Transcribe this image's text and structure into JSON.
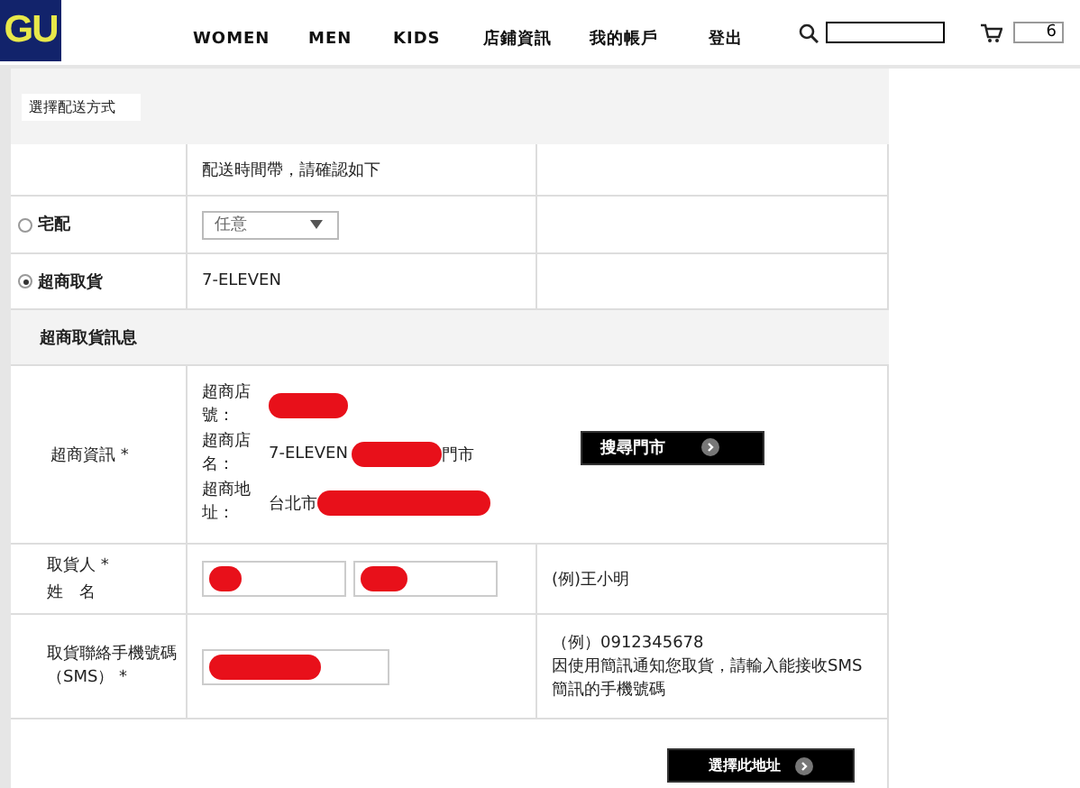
{
  "header": {
    "logo": "GU",
    "nav": [
      "WOMEN",
      "MEN",
      "KIDS",
      "店鋪資訊",
      "我的帳戶",
      "登出"
    ],
    "cart_count": "6"
  },
  "section_title": "選擇配送方式",
  "delivery_note": "配送時間帶，請確認如下",
  "options": [
    {
      "label": "宅配",
      "selected": false,
      "kind": "select",
      "value": "任意"
    },
    {
      "label": "超商取貨",
      "selected": true,
      "kind": "text",
      "value": "7-ELEVEN"
    }
  ],
  "subheading": "超商取貨訊息",
  "store": {
    "label": "超商資訊 *",
    "fields": [
      {
        "label": "超商店號：",
        "redacted": true
      },
      {
        "label": "超商店名：",
        "prefix": "7-ELEVEN",
        "redacted": true,
        "suffix": "門市"
      },
      {
        "label": "超商地址：",
        "prefix": "台北市",
        "redacted": true
      }
    ],
    "button": "搜尋門市"
  },
  "recipient": {
    "label_lines": [
      "取貨人 *",
      "姓　名"
    ],
    "inputs": [
      {
        "redacted": true
      },
      {
        "redacted": true
      }
    ],
    "example": "(例)王小明"
  },
  "phone": {
    "label": "取貨聯絡手機號碼（SMS） *",
    "input": {
      "redacted": true
    },
    "example": "（例）0912345678",
    "note": "因使用簡訊通知您取貨，請輸入能接收SMS簡訊的手機號碼"
  },
  "submit": "選擇此地址"
}
